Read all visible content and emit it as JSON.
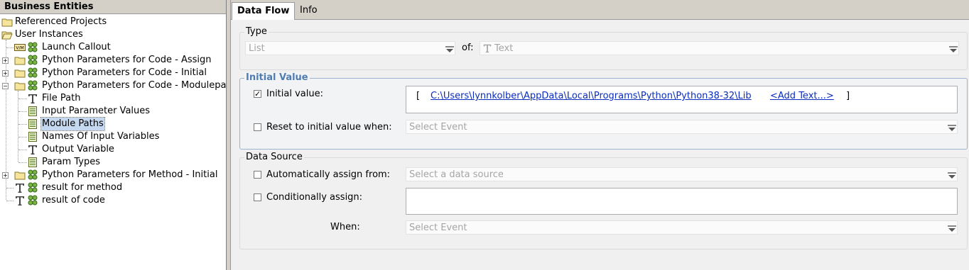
{
  "tree": {
    "header": "Business Entities",
    "items": [
      {
        "label": "Referenced Projects",
        "icon": "folder-icon"
      },
      {
        "label": "User Instances",
        "icon": "folder-open-icon"
      },
      {
        "label": "Launch Callout",
        "icon": "vm-icon"
      },
      {
        "label": "Python Parameters for Code - Assign",
        "icon": "folder-icon"
      },
      {
        "label": "Python Parameters for Code - Initial",
        "icon": "folder-icon"
      },
      {
        "label": "Python Parameters for Code - Modulepat",
        "icon": "folder-icon"
      },
      {
        "label": "File Path",
        "icon": "text-type-icon"
      },
      {
        "label": "Input Parameter Values",
        "icon": "list-icon"
      },
      {
        "label": "Module Paths",
        "icon": "list-icon"
      },
      {
        "label": "Names Of Input Variables",
        "icon": "list-icon"
      },
      {
        "label": "Output Variable",
        "icon": "text-type-icon"
      },
      {
        "label": "Param Types",
        "icon": "list-icon"
      },
      {
        "label": "Python Parameters for Method - Initial",
        "icon": "folder-icon"
      },
      {
        "label": "result for method",
        "icon": "text-type-icon"
      },
      {
        "label": "result of code",
        "icon": "text-type-icon"
      }
    ],
    "vm_label": "V/M"
  },
  "tabs": [
    "Data Flow",
    "Info"
  ],
  "type_group": {
    "title": "Type",
    "type_value": "List",
    "of_label": "of:",
    "of_value": "Text"
  },
  "initial_group": {
    "title": "Initial Value",
    "initial_label": "Initial value:",
    "initial_checked": true,
    "bracket_open": "[",
    "path_value": "C:\\Users\\lynnkolber\\AppData\\Local\\Programs\\Python\\Python38-32\\Lib",
    "add_text": "<Add Text...>",
    "bracket_close": "]",
    "reset_label": "Reset to initial value when:",
    "reset_placeholder": "Select Event"
  },
  "source_group": {
    "title": "Data Source",
    "auto_label": "Automatically assign from:",
    "auto_placeholder": "Select a data source",
    "cond_label": "Conditionally assign:",
    "when_label": "When:",
    "when_placeholder": "Select Event"
  },
  "colors": {
    "selection": "#c5d8f0",
    "link": "#0b2dbf",
    "group_highlight": "#4f7db3"
  }
}
